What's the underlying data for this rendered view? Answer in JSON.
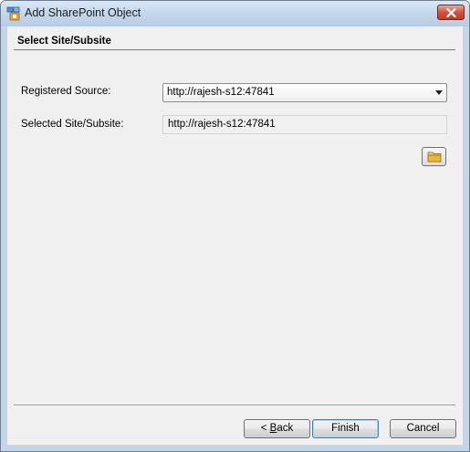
{
  "window": {
    "title": "Add SharePoint Object"
  },
  "section": {
    "title": "Select Site/Subsite"
  },
  "form": {
    "registered_source_label": "Registered Source:",
    "registered_source_value": "http://rajesh-s12:47841",
    "selected_site_label": "Selected Site/Subsite:",
    "selected_site_value": "http://rajesh-s12:47841"
  },
  "buttons": {
    "back_mnemonic": "< ",
    "back_underline": "B",
    "back_rest": "ack",
    "finish": "Finish",
    "cancel": "Cancel"
  },
  "icons": {
    "app": "sharepoint-app-icon",
    "close": "close-icon",
    "dropdown": "chevron-down-icon",
    "browse": "folder-icon"
  },
  "colors": {
    "close_button": "#c33b22",
    "folder": "#e8b93a",
    "default_button_border": "#3c7fb1"
  }
}
